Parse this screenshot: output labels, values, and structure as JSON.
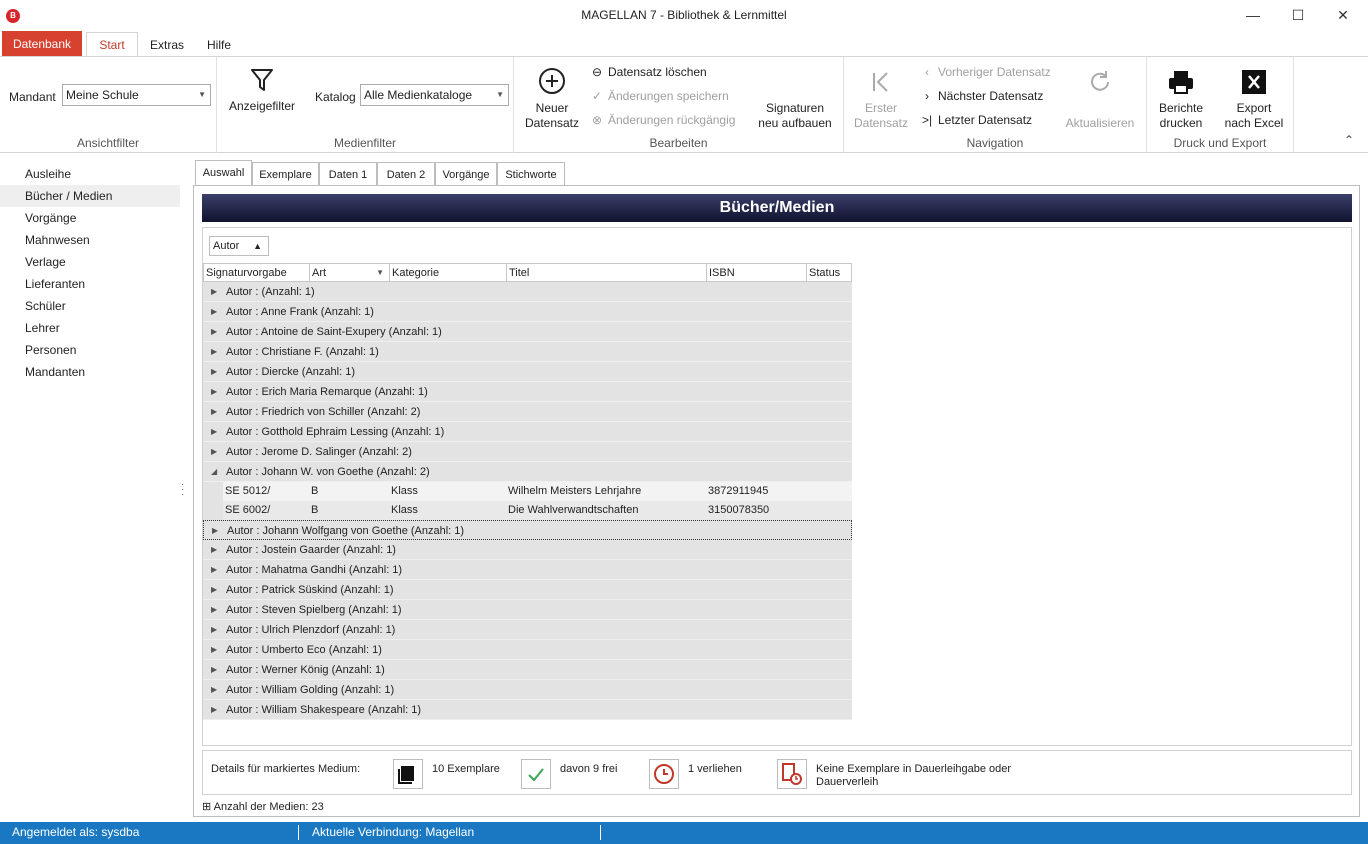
{
  "window": {
    "title": "MAGELLAN 7 - Bibliothek & Lernmittel",
    "app_icon": "B",
    "minimize": "—",
    "maximize": "☐",
    "close": "✕"
  },
  "ribbon_tabs": [
    "Datenbank",
    "Start",
    "Extras",
    "Hilfe"
  ],
  "ribbon": {
    "mandant_label": "Mandant",
    "mandant_value": "Meine Schule",
    "group_ansichtfilter": "Ansichtfilter",
    "anzeigefilter": "Anzeigefilter",
    "katalog_label": "Katalog",
    "katalog_value": "Alle Medienkataloge",
    "group_medienfilter": "Medienfilter",
    "neuer_datensatz_1": "Neuer",
    "neuer_datensatz_2": "Datensatz",
    "datensatz_loeschen": "Datensatz löschen",
    "aenderungen_speichern": "Änderungen speichern",
    "aenderungen_rueckgaengig": "Änderungen rückgängig",
    "signaturen_1": "Signaturen",
    "signaturen_2": "neu aufbauen",
    "group_bearbeiten": "Bearbeiten",
    "erster_1": "Erster",
    "erster_2": "Datensatz",
    "vorheriger": "Vorheriger Datensatz",
    "naechster": "Nächster Datensatz",
    "letzter": "Letzter Datensatz",
    "aktualisieren": "Aktualisieren",
    "group_navigation": "Navigation",
    "berichte_1": "Berichte",
    "berichte_2": "drucken",
    "export_1": "Export",
    "export_2": "nach Excel",
    "group_druck": "Druck und Export",
    "collapse": "⌃"
  },
  "nav_items": [
    "Ausleihe",
    "Bücher / Medien",
    "Vorgänge",
    "Mahnwesen",
    "Verlage",
    "Lieferanten",
    "Schüler",
    "Lehrer",
    "Personen",
    "Mandanten"
  ],
  "content_tabs": [
    "Auswahl",
    "Exemplare",
    "Daten 1",
    "Daten 2",
    "Vorgänge",
    "Stichworte"
  ],
  "panel_title": "Bücher/Medien",
  "group_by": "Autor",
  "columns": [
    "Signaturvorgabe",
    "Art",
    "Kategorie",
    "Titel",
    "ISBN",
    "Status"
  ],
  "groups_before": [
    "Autor :  (Anzahl: 1)",
    "Autor : Anne Frank (Anzahl: 1)",
    "Autor : Antoine de Saint-Exupery (Anzahl: 1)",
    "Autor : Christiane F. (Anzahl: 1)",
    "Autor : Diercke (Anzahl: 1)",
    "Autor : Erich Maria Remarque (Anzahl: 1)",
    "Autor : Friedrich von Schiller (Anzahl: 2)",
    "Autor : Gotthold Ephraim Lessing (Anzahl: 1)",
    "Autor : Jerome D. Salinger (Anzahl: 2)"
  ],
  "expanded_group": "Autor : Johann W. von Goethe (Anzahl: 2)",
  "expanded_rows": [
    {
      "sig": "SE 5012/",
      "art": "B",
      "kat": "Klass",
      "titel": "Wilhelm Meisters Lehrjahre",
      "isbn": "3872911945",
      "status": ""
    },
    {
      "sig": "SE 6002/",
      "art": "B",
      "kat": "Klass",
      "titel": "Die Wahlverwandtschaften",
      "isbn": "3150078350",
      "status": ""
    }
  ],
  "focused_group": "Autor : Johann Wolfgang von Goethe (Anzahl: 1)",
  "groups_after": [
    "Autor : Jostein Gaarder (Anzahl: 1)",
    "Autor : Mahatma Gandhi (Anzahl: 1)",
    "Autor : Patrick Süskind (Anzahl: 1)",
    "Autor : Steven Spielberg (Anzahl: 1)",
    "Autor : Ulrich Plenzdorf (Anzahl: 1)",
    "Autor : Umberto Eco (Anzahl: 1)",
    "Autor : Werner König (Anzahl: 1)",
    "Autor : William Golding (Anzahl: 1)",
    "Autor : William Shakespeare (Anzahl: 1)"
  ],
  "details": {
    "label": "Details für markiertes Medium:",
    "exemplare": "10 Exemplare",
    "frei": "davon 9 frei",
    "verliehen": "1 verliehen",
    "dauerleih_1": "Keine Exemplare in Dauerleihgabe oder",
    "dauerleih_2": "Dauerverleih"
  },
  "count_text": "Anzahl der Medien: 23",
  "status": {
    "user": "Angemeldet als: sysdba",
    "connection": "Aktuelle Verbindung: Magellan"
  },
  "colors": {
    "accent_red": "#d7412f",
    "status_blue": "#1a78c2",
    "header_navy": "#1b1e40"
  }
}
